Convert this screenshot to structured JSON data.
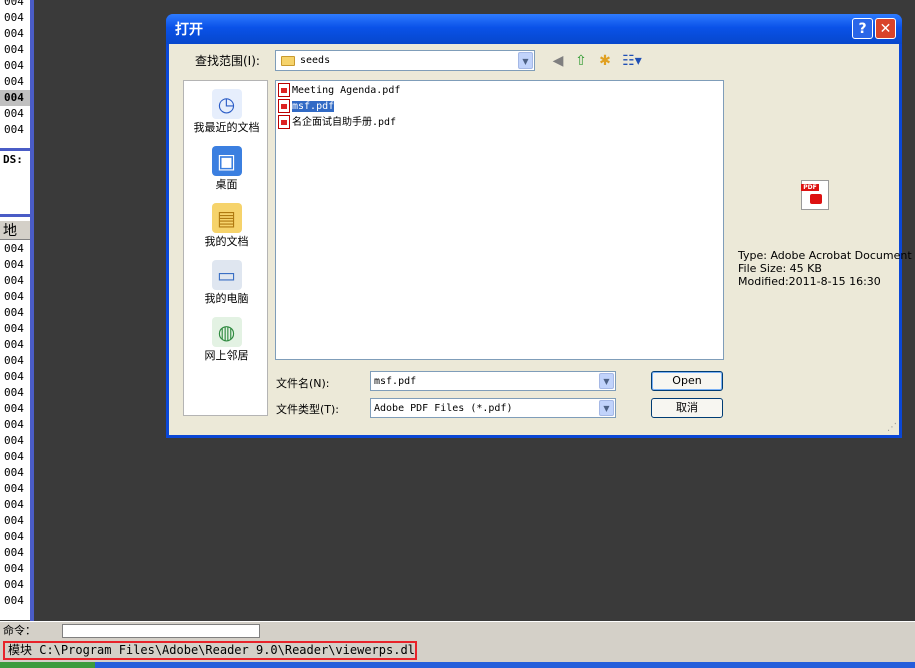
{
  "debugger": {
    "row_prefix": "004",
    "ds_label": "DS:",
    "addr_header": "地址",
    "command_label": "命令：",
    "status_text": "模块 C:\\Program Files\\Adobe\\Reader 9.0\\Reader\\viewerps.dll"
  },
  "dialog": {
    "title": "打开",
    "help_glyph": "?",
    "close_glyph": "✕",
    "look_in_label": "查找范围(I):",
    "look_in_value": "seeds",
    "places": [
      {
        "label": "我最近的文档",
        "icon": "recent-documents-icon"
      },
      {
        "label": "桌面",
        "icon": "desktop-icon"
      },
      {
        "label": "我的文档",
        "icon": "my-documents-icon"
      },
      {
        "label": "我的电脑",
        "icon": "my-computer-icon"
      },
      {
        "label": "网上邻居",
        "icon": "network-places-icon"
      }
    ],
    "files": [
      {
        "name": "Meeting Agenda.pdf",
        "selected": false
      },
      {
        "name": "msf.pdf",
        "selected": true
      },
      {
        "name": "名企面试自助手册.pdf",
        "selected": false
      }
    ],
    "filename_label": "文件名(N):",
    "filename_value": "msf.pdf",
    "filetype_label": "文件类型(T):",
    "filetype_value": "Adobe PDF Files (*.pdf)",
    "open_label": "Open",
    "cancel_label": "取消",
    "preview": {
      "type_line": "Type: Adobe Acrobat Document",
      "size_line": "File Size: 45 KB",
      "modified_line": "Modified:2011-8-15 16:30",
      "icon_badge": "PDF"
    }
  }
}
